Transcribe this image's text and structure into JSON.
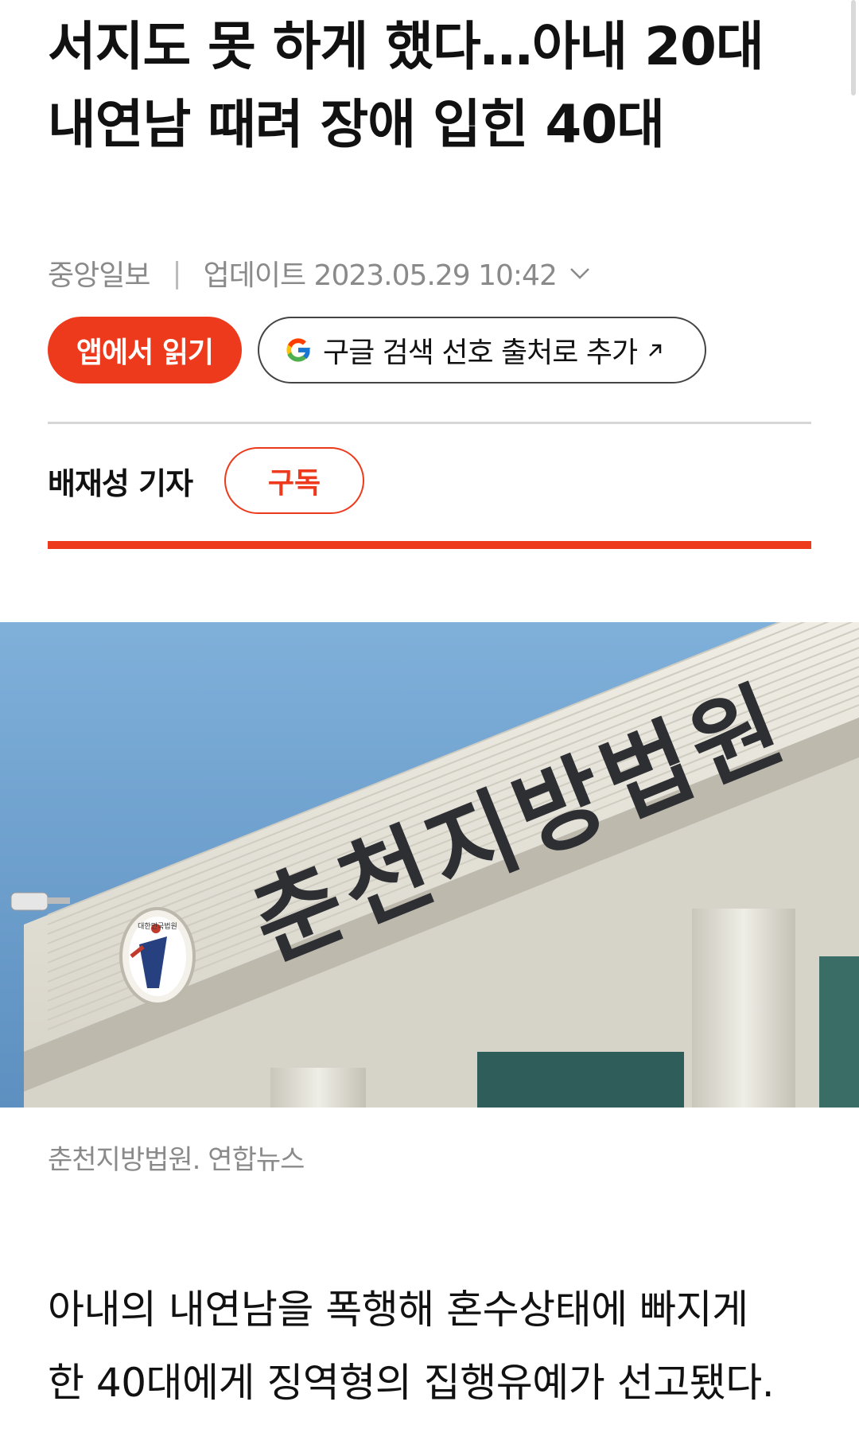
{
  "article": {
    "headline_line1": "서지도 못 하게 했다…아내 20대",
    "headline_line2": "내연남 때려 장애 입힌 40대",
    "source": "중앙일보",
    "separator": "|",
    "updated_label": "업데이트 2023.05.29 10:42",
    "reporter": "배재성 기자",
    "caption": "춘천지방법원. 연합뉴스",
    "body_line1": "아내의 내연남을 폭행해 혼수상태에 빠지게",
    "body_line2": "한 40대에게 징역형의 집행유예가 선고됐다."
  },
  "buttons": {
    "app_read": "앱에서 읽기",
    "google_pref": "구글 검색 선호 출처로 추가",
    "subscribe": "구독"
  },
  "photo": {
    "sign_text": "춘천지방법원",
    "emblem_text": "대한민국법원"
  },
  "colors": {
    "accent": "#ee3a1c",
    "meta_gray": "#8a8a8a",
    "sky": "#6f9fcb",
    "building": "#e8e6dd"
  },
  "icons": {
    "dropdown": "chevron-down-icon",
    "google": "google-g-icon",
    "external": "arrow-up-right-icon"
  }
}
